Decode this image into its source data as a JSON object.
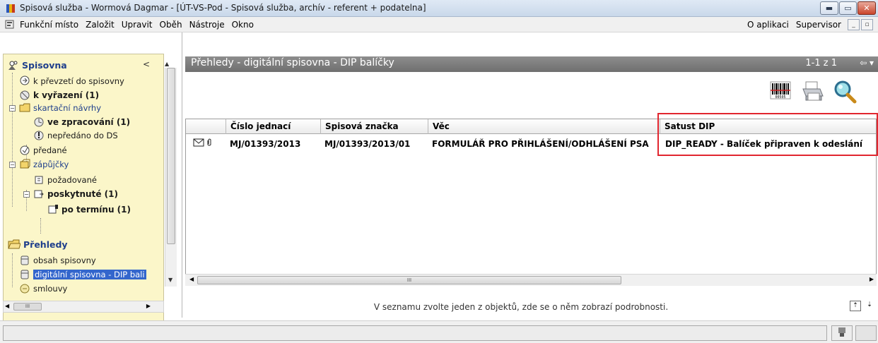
{
  "window": {
    "title": "Spisová služba - Wormová Dagmar - [ÚT-VS-Pod - Spisová služba, archív - referent + podatelna]",
    "min_label": "▬",
    "max_label": "▭",
    "close_label": "✕"
  },
  "menu": {
    "items": [
      "Funkční místo",
      "Založit",
      "Upravit",
      "Oběh",
      "Nástroje",
      "Okno"
    ],
    "right_items": [
      "O aplikaci",
      "Supervisor"
    ],
    "mdi_min": "_",
    "mdi_restore": "▫"
  },
  "sidebar": {
    "collapse_label": "<",
    "sections": [
      {
        "title": "Spisovna",
        "items": [
          {
            "label": "k převzetí do spisovny",
            "bold": false,
            "icon": "document-arrow-icon"
          },
          {
            "label": "k vyřazení (1)",
            "bold": true,
            "icon": "archive-discard-icon"
          },
          {
            "label": "skartační návrhy",
            "bold": false,
            "blue": true,
            "icon": "folder-icon"
          },
          {
            "label": "ve zpracování (1)",
            "bold": true,
            "icon": "processing-icon"
          },
          {
            "label": "nepředáno do DS",
            "bold": false,
            "icon": "warning-icon"
          },
          {
            "label": "předané",
            "bold": false,
            "icon": "handed-icon"
          },
          {
            "label": "zápůjčky",
            "bold": false,
            "blue": true,
            "icon": "loan-icon"
          },
          {
            "label": "požadované",
            "bold": false,
            "icon": "requested-icon"
          },
          {
            "label": "poskytnuté (1)",
            "bold": true,
            "icon": "provided-icon"
          },
          {
            "label": "po termínu (1)",
            "bold": true,
            "icon": "overdue-icon"
          }
        ]
      },
      {
        "title": "Přehledy",
        "items": [
          {
            "label": "obsah spisovny",
            "icon": "archive-box-icon"
          },
          {
            "label": "digitální spisovna - DIP bali",
            "icon": "archive-box-icon",
            "selected": true
          },
          {
            "label": "smlouvy",
            "icon": "contract-icon"
          }
        ]
      }
    ],
    "scroll_thumb_label": "III"
  },
  "content": {
    "title": "Přehledy - digitální spisovna - DIP balíčky",
    "pager": "1-1 z 1",
    "pager_button": "⇦ ▾",
    "columns": [
      "Číslo jednací",
      "Spisová značka",
      "Věc",
      "Satust DIP"
    ],
    "rows": [
      {
        "cislo_jednaci": "MJ/01393/2013",
        "spisova_znacka": "MJ/01393/2013/01",
        "vec": "FORMULÁŘ PRO PŘIHLÁŠENÍ/ODHLÁŠENÍ PSA",
        "status_dip": "DIP_READY - Balíček připraven k odeslání"
      }
    ],
    "scroll_thumb_label": "III",
    "hint": "V seznamu zvolte jeden z objektů, zde se o něm zobrazí podrobnosti.",
    "detail_up": "⇡",
    "detail_down": "⇣"
  },
  "toolbar": {
    "barcode_caption": "00505"
  },
  "colors": {
    "accent": "#3366cc",
    "header_gray": "#7a7a7a",
    "highlight_red": "#e1262f",
    "tree_bg": "#fbf6c9"
  }
}
